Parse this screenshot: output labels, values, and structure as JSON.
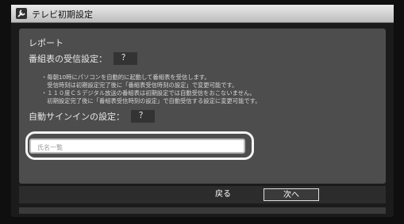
{
  "window": {
    "title": "テレビ初期設定"
  },
  "panel": {
    "section_label": "レポート",
    "epg_setting": {
      "label": "番組表の受信設定：",
      "value": "？"
    },
    "notes": [
      "・毎朝10時にパソコンを自動的に起動して番組表を受信します。",
      "　受信時刻は初期設定完了後に「番組表受信時刻の設定」で変更可能です。",
      "・１１０度ＣＳデジタル放送の番組表は初期設定では自動受信をおこないません。",
      "　初期設定完了後に「番組表受信時刻の設定」で自動受信する設定に変更可能です。"
    ],
    "auto_signin": {
      "label": "自動サインインの設定：",
      "value": "？"
    },
    "name_field": {
      "value": "氏名一覧"
    }
  },
  "footer": {
    "back_label": "戻る",
    "next_label": "次へ"
  }
}
